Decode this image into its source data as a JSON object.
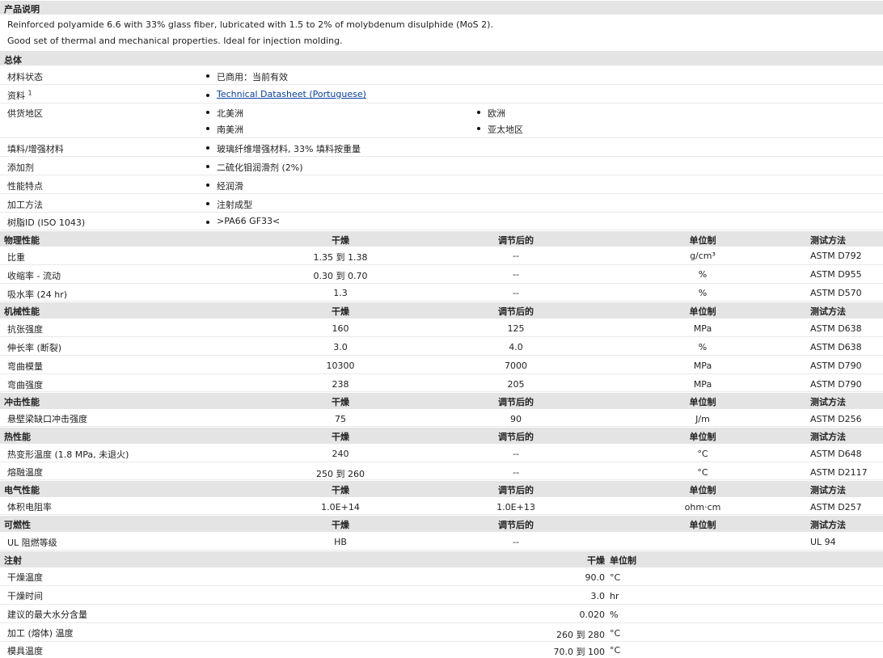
{
  "description": {
    "title": "产品说明",
    "lines": [
      "Reinforced polyamide 6.6 with 33% glass fiber, lubricated with 1.5 to 2% of molybdenum disulphide (MoS 2).",
      "Good set of thermal and mechanical properties. Ideal for injection molding."
    ]
  },
  "general": {
    "title": "总体",
    "rows": [
      {
        "label": "材料状态",
        "value": "已商用：当前有效"
      },
      {
        "label": "资料",
        "sup": "1",
        "value": "Technical Datasheet (Portuguese)"
      },
      {
        "label": "供货地区",
        "regions": [
          "北美洲",
          "欧洲",
          "南美洲",
          "亚太地区"
        ]
      },
      {
        "label": "填料/增强材料",
        "value": "玻璃纤维增强材料, 33% 填料按重量"
      },
      {
        "label": "添加剂",
        "value": "二硫化钼润滑剂 (2%)"
      },
      {
        "label": "性能特点",
        "value": "经润滑"
      },
      {
        "label": "加工方法",
        "value": "注射成型"
      },
      {
        "label": "树脂ID (ISO 1043)",
        "value": ">PA66 GF33<"
      }
    ]
  },
  "columns": {
    "dry": "干燥",
    "conditioned": "调节后的",
    "unit": "单位制",
    "method": "测试方法"
  },
  "physical": {
    "title": "物理性能",
    "rows": [
      {
        "name": "比重",
        "dry": "1.35 到  1.38",
        "cond": "--",
        "unit": "g/cm³",
        "method": "ASTM D792"
      },
      {
        "name": "收缩率 - 流动",
        "dry": "0.30 到  0.70",
        "cond": "--",
        "unit": "%",
        "method": "ASTM D955"
      },
      {
        "name": "吸水率 (24 hr)",
        "dry": "1.3",
        "cond": "--",
        "unit": "%",
        "method": "ASTM D570"
      }
    ]
  },
  "mechanical": {
    "title": "机械性能",
    "rows": [
      {
        "name": "抗张强度",
        "dry": "160",
        "cond": "125",
        "unit": "MPa",
        "method": "ASTM D638"
      },
      {
        "name": "伸长率 (断裂)",
        "dry": "3.0",
        "cond": "4.0",
        "unit": "%",
        "method": "ASTM D638"
      },
      {
        "name": "弯曲模量",
        "dry": "10300",
        "cond": "7000",
        "unit": "MPa",
        "method": "ASTM D790"
      },
      {
        "name": "弯曲强度",
        "dry": "238",
        "cond": "205",
        "unit": "MPa",
        "method": "ASTM D790"
      }
    ]
  },
  "impact": {
    "title": "冲击性能",
    "rows": [
      {
        "name": "悬壁梁缺口冲击强度",
        "dry": "75",
        "cond": "90",
        "unit": "J/m",
        "method": "ASTM D256"
      }
    ]
  },
  "thermal": {
    "title": "热性能",
    "rows": [
      {
        "name": "热变形温度 (1.8 MPa, 未退火)",
        "dry": "240",
        "cond": "--",
        "unit": "°C",
        "method": "ASTM D648"
      },
      {
        "name": "熔融温度",
        "dry": "250 到  260",
        "cond": "--",
        "unit": "°C",
        "method": "ASTM D2117"
      }
    ]
  },
  "electrical": {
    "title": "电气性能",
    "rows": [
      {
        "name": "体积电阻率",
        "dry": "1.0E+14",
        "cond": "1.0E+13",
        "unit": "ohm·cm",
        "method": "ASTM D257"
      }
    ]
  },
  "flammability": {
    "title": "可燃性",
    "rows": [
      {
        "name": "UL 阻燃等级",
        "dry": "HB",
        "cond": "--",
        "unit": "",
        "method": "UL 94"
      }
    ]
  },
  "injection": {
    "title": "注射",
    "col_dry": "干燥",
    "col_unit": "单位制",
    "rows": [
      {
        "name": "干燥温度",
        "value": "90.0",
        "unit": "°C"
      },
      {
        "name": "干燥时间",
        "value": "3.0",
        "unit": "hr"
      },
      {
        "name": "建议的最大水分含量",
        "value": "0.020",
        "unit": "%"
      },
      {
        "name": "加工 (熔体) 温度",
        "value": "260 到  280",
        "unit": "°C"
      },
      {
        "name": "模具温度",
        "value": "70.0 到  100",
        "unit": "°C"
      }
    ]
  }
}
